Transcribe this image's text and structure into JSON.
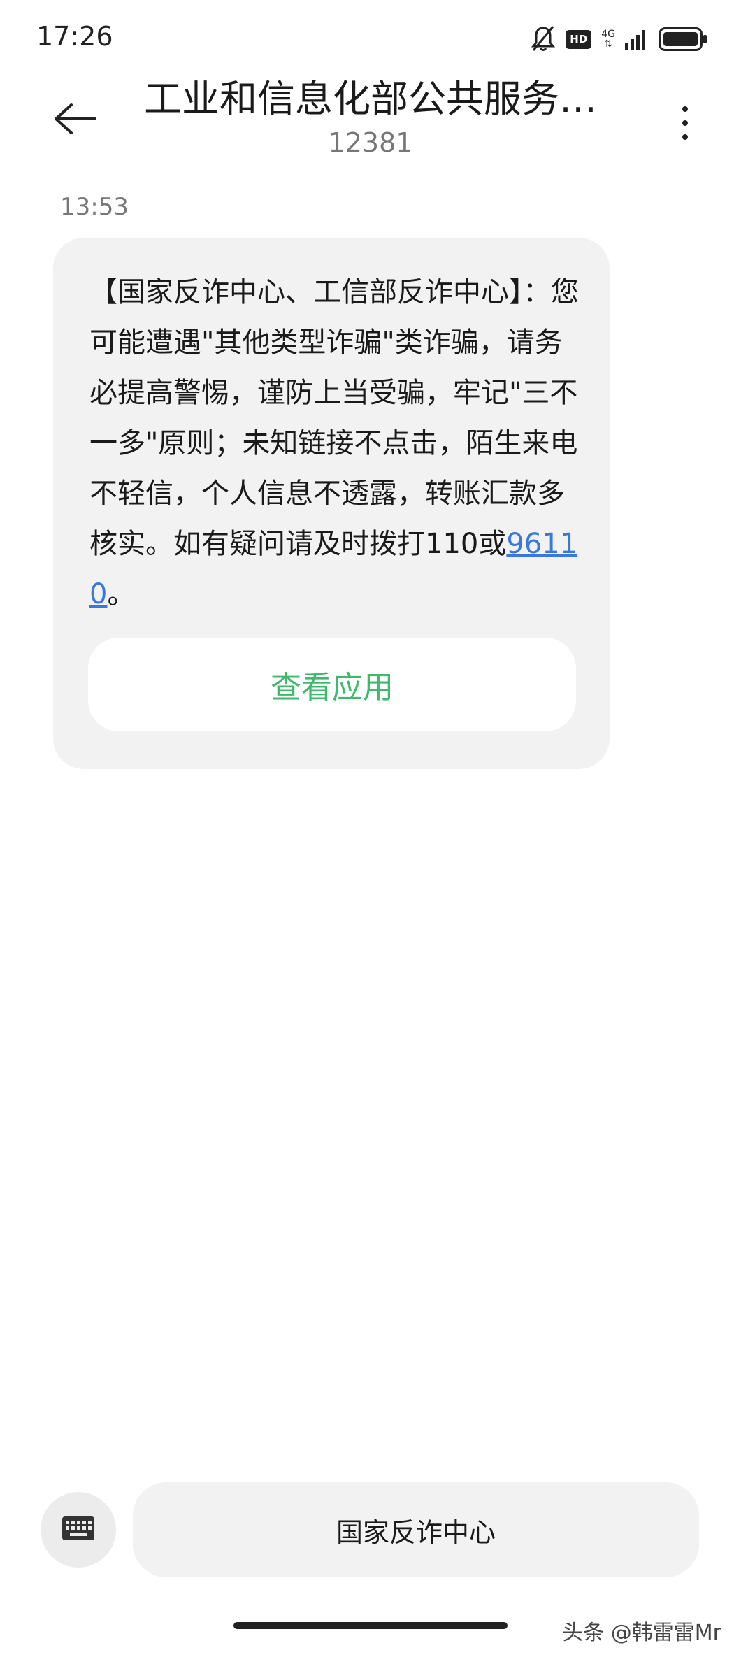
{
  "status_bar": {
    "time": "17:26",
    "hd_label": "HD",
    "network_label": "4G",
    "icons": [
      "bell-off-icon",
      "hd-icon",
      "signal-icon",
      "battery-icon"
    ]
  },
  "header": {
    "title": "工业和信息化部公共服务…",
    "subtitle": "12381",
    "back_icon": "back-arrow-icon",
    "more_icon": "more-vert-icon"
  },
  "conversation": {
    "time": "13:53",
    "message": {
      "text_before_link": "【国家反诈中心、工信部反诈中心】：您可能遭遇\"其他类型诈骗\"类诈骗，请务必提高警惕，谨防上当受骗，牢记\"三不一多\"原则；未知链接不点击，陌生来电不轻信，个人信息不透露，转账汇款多核实。如有疑问请及时拨打110或",
      "link_text": "96110",
      "text_after_link": "。"
    },
    "action_button_label": "查看应用",
    "action_color": "#3fba6a",
    "link_color": "#3a78e0"
  },
  "bottom": {
    "keyboard_icon": "keyboard-icon",
    "quick_reply_label": "国家反诈中心"
  },
  "watermark": "头条 @韩雷雷Mr"
}
